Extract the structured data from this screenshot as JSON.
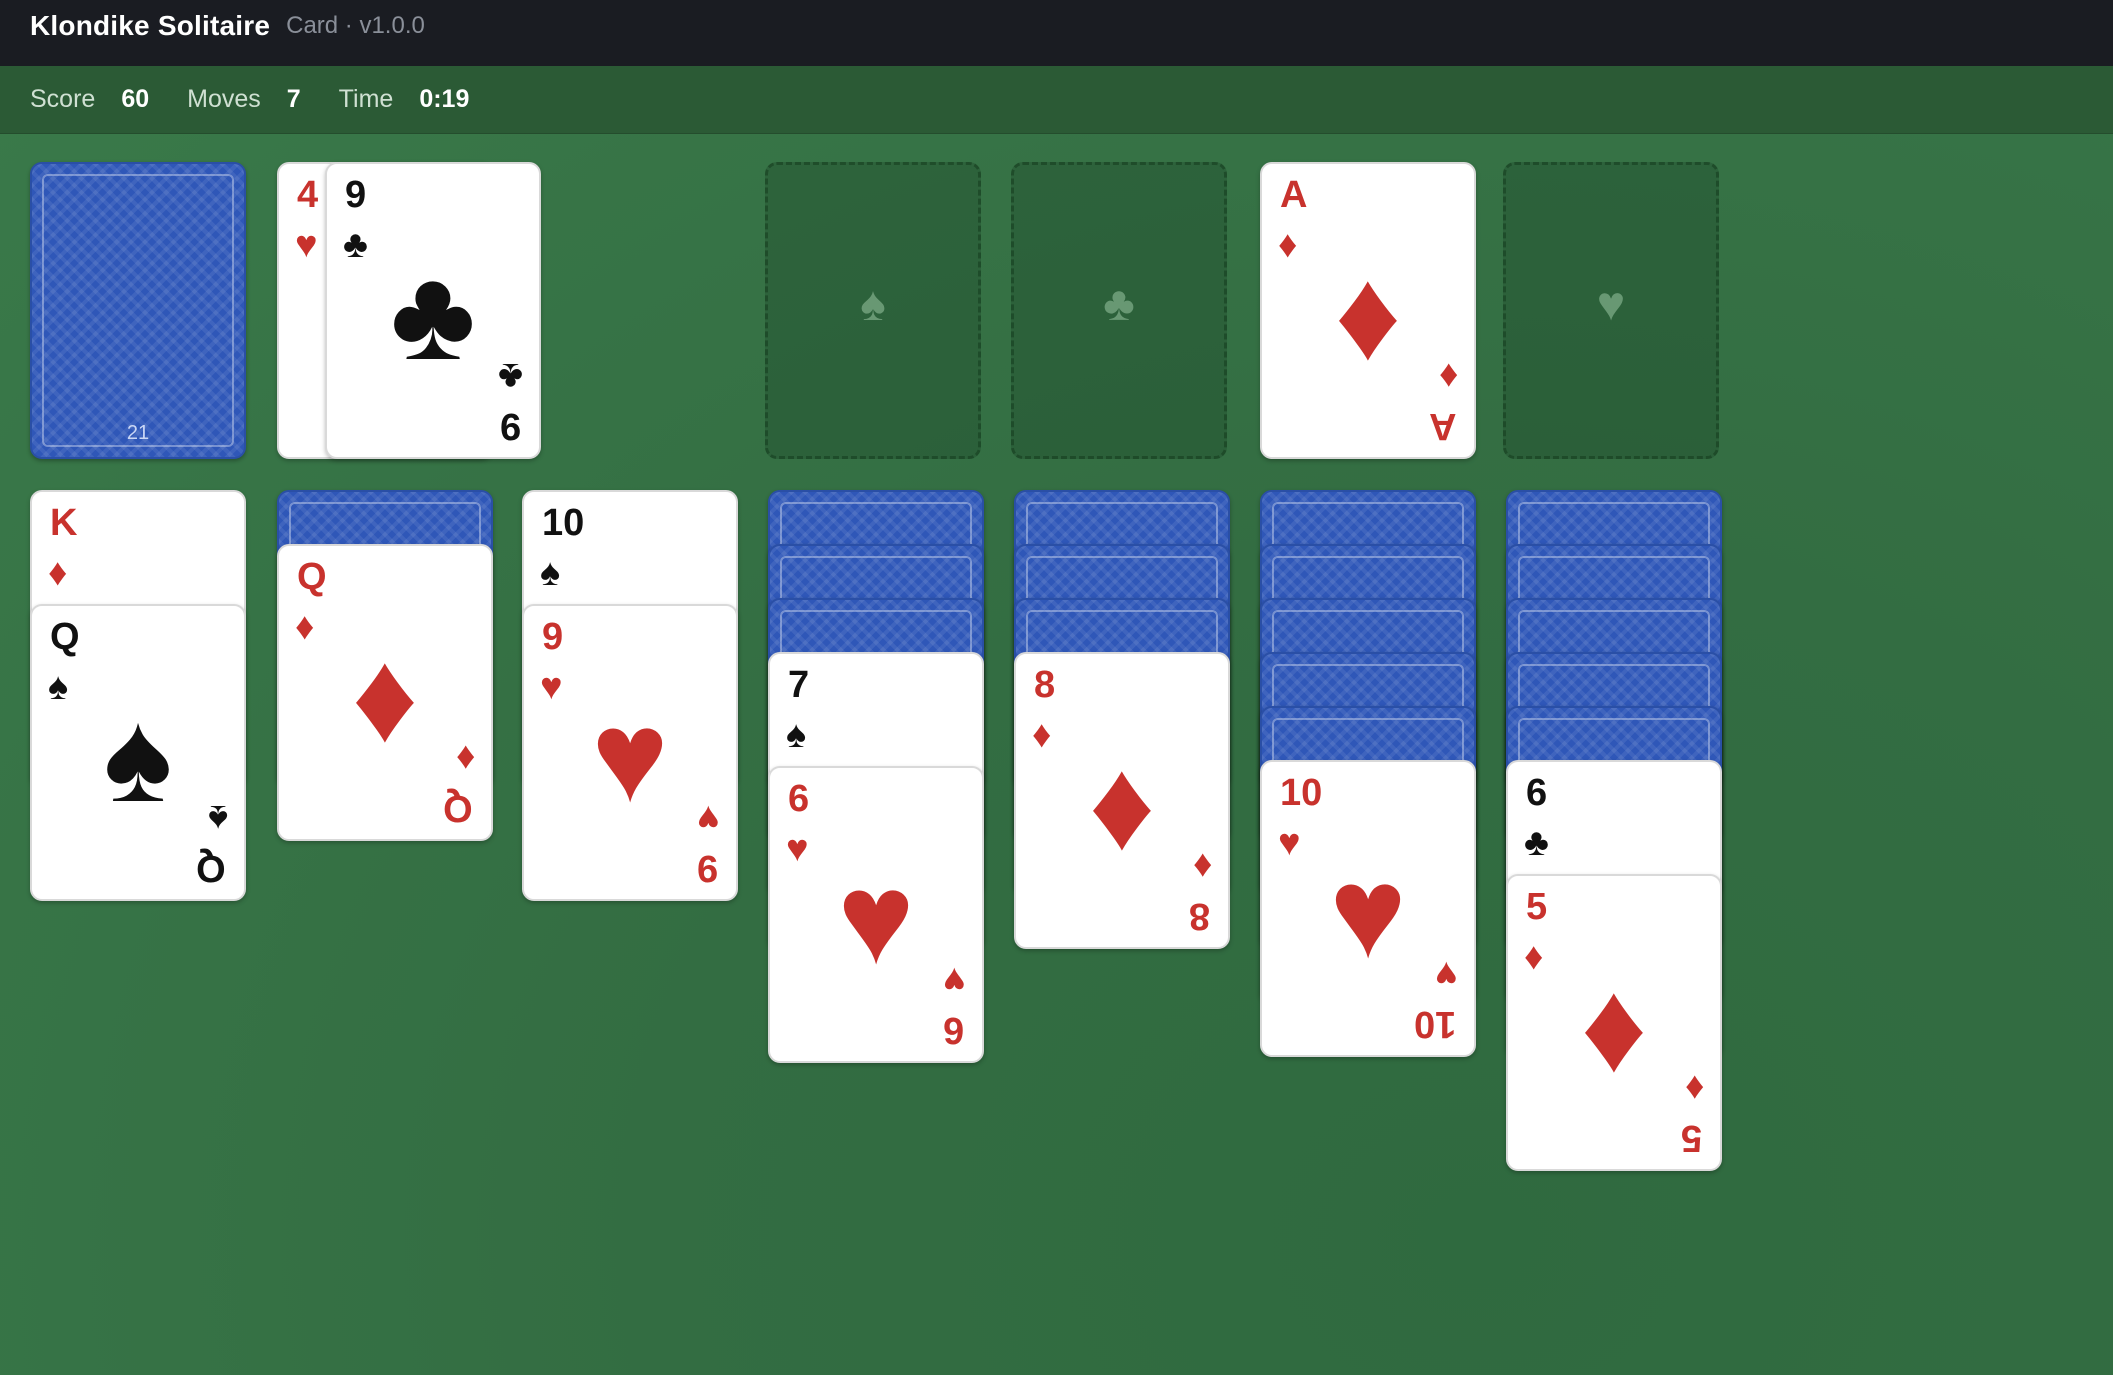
{
  "app": {
    "title": "Klondike Solitaire",
    "meta": "Card · v1.0.0"
  },
  "stats": {
    "score_label": "Score",
    "score": "60",
    "moves_label": "Moves",
    "moves": "7",
    "time_label": "Time",
    "time": "0:19"
  },
  "stock": {
    "count": "21"
  },
  "waste": [
    {
      "rank": "4",
      "suit": "♥",
      "color": "red"
    },
    {
      "rank": "9",
      "suit": "♣",
      "color": "black"
    }
  ],
  "foundations": [
    {
      "empty_suit": "♠"
    },
    {
      "empty_suit": "♣"
    },
    {
      "rank": "A",
      "suit": "♦",
      "color": "red"
    },
    {
      "empty_suit": "♥"
    }
  ],
  "tableau": [
    {
      "face_down": 0,
      "cards": [
        {
          "rank": "K",
          "suit": "♦",
          "color": "red"
        },
        {
          "rank": "Q",
          "suit": "♠",
          "color": "black"
        }
      ]
    },
    {
      "face_down": 1,
      "cards": [
        {
          "rank": "Q",
          "suit": "♦",
          "color": "red"
        }
      ]
    },
    {
      "face_down": 0,
      "cards": [
        {
          "rank": "10",
          "suit": "♠",
          "color": "black"
        },
        {
          "rank": "9",
          "suit": "♥",
          "color": "red"
        }
      ]
    },
    {
      "face_down": 3,
      "cards": [
        {
          "rank": "7",
          "suit": "♠",
          "color": "black"
        },
        {
          "rank": "6",
          "suit": "♥",
          "color": "red"
        }
      ]
    },
    {
      "face_down": 3,
      "cards": [
        {
          "rank": "8",
          "suit": "♦",
          "color": "red"
        }
      ]
    },
    {
      "face_down": 5,
      "cards": [
        {
          "rank": "10",
          "suit": "♥",
          "color": "red"
        }
      ]
    },
    {
      "face_down": 5,
      "cards": [
        {
          "rank": "6",
          "suit": "♣",
          "color": "black"
        },
        {
          "rank": "5",
          "suit": "♦",
          "color": "red"
        }
      ]
    }
  ]
}
